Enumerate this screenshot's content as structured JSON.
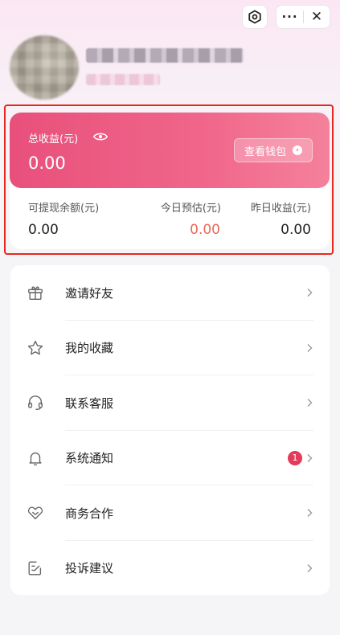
{
  "header": {
    "settings_icon": "hexagon-settings-icon",
    "more_label": "···",
    "close_label": "✕"
  },
  "earnings": {
    "total_label": "总收益(元)",
    "total_value": "0.00",
    "wallet_button": "查看钱包",
    "stats": [
      {
        "label": "可提现余额(元)",
        "value": "0.00"
      },
      {
        "label": "今日预估(元)",
        "value": "0.00"
      },
      {
        "label": "昨日收益(元)",
        "value": "0.00"
      }
    ]
  },
  "menu": [
    {
      "label": "邀请好友",
      "icon": "gift-icon"
    },
    {
      "label": "我的收藏",
      "icon": "star-icon"
    },
    {
      "label": "联系客服",
      "icon": "headset-icon"
    },
    {
      "label": "系统通知",
      "icon": "bell-icon",
      "badge": "1"
    },
    {
      "label": "商务合作",
      "icon": "handshake-heart-icon"
    },
    {
      "label": "投诉建议",
      "icon": "feedback-icon"
    }
  ],
  "colors": {
    "accent": "#ee5d83",
    "badge": "#e63a5a",
    "today_value": "#e86a55",
    "highlight_border": "#e8271f"
  }
}
